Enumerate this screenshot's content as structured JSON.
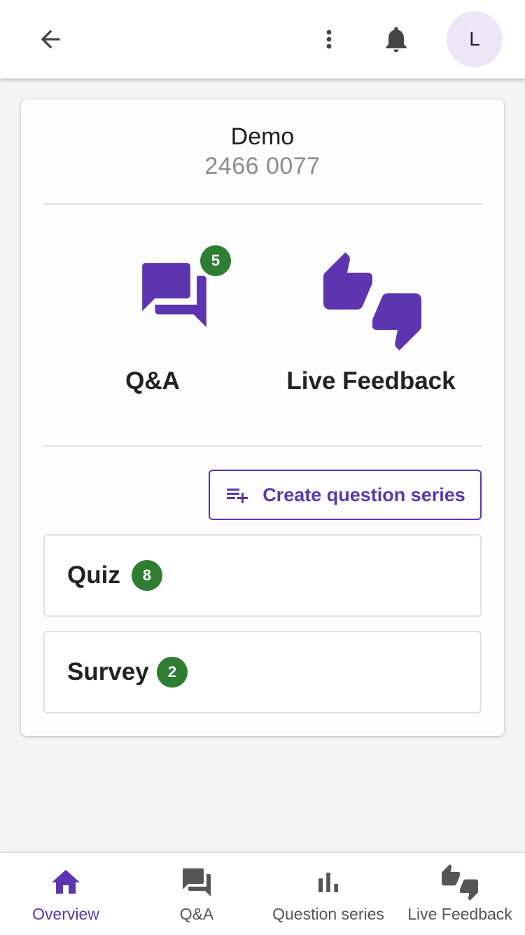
{
  "app": {
    "avatar_initial": "L"
  },
  "room": {
    "name": "Demo",
    "code": "2466 0077"
  },
  "features": [
    {
      "label": "Q&A",
      "badge": "5",
      "icon": "forum-icon"
    },
    {
      "label": "Live Feedback",
      "icon": "thumbs-up-down-icon"
    }
  ],
  "create_series": {
    "label": "Create question series",
    "icon": "playlist-add-icon"
  },
  "series": [
    {
      "label": "Quiz",
      "count": "8"
    },
    {
      "label": "Survey",
      "count": "2"
    }
  ],
  "bottom_nav": [
    {
      "label": "Overview",
      "icon": "home-icon",
      "active": true
    },
    {
      "label": "Q&A",
      "icon": "forum-icon",
      "active": false
    },
    {
      "label": "Question series",
      "icon": "bar-chart-icon",
      "active": false
    },
    {
      "label": "Live Feedback",
      "icon": "thumbs-up-down-icon",
      "active": false
    }
  ],
  "colors": {
    "accent": "#5e35b1",
    "badge": "#2e7d32",
    "avatar_bg": "#ece6f7",
    "background": "#f4f4f4"
  }
}
